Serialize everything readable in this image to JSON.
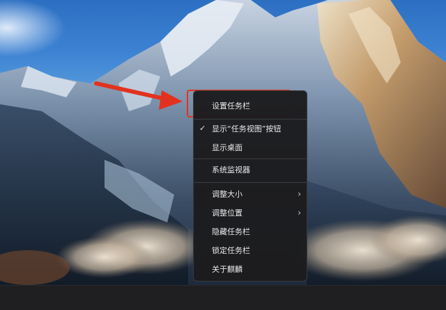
{
  "context_menu": {
    "items": [
      {
        "label": "设置任务栏"
      },
      {
        "label": "显示“任务视图”按钮",
        "checked": true,
        "check_glyph": "✓"
      },
      {
        "label": "显示桌面"
      },
      {
        "label": "系统监视器"
      },
      {
        "label": "调整大小",
        "submenu": true,
        "chevron": "›"
      },
      {
        "label": "调整位置",
        "submenu": true,
        "chevron": "›"
      },
      {
        "label": "隐藏任务栏"
      },
      {
        "label": "锁定任务栏"
      },
      {
        "label": "关于麒麟"
      }
    ]
  },
  "annotation": {
    "arrow_color": "#e2321f",
    "box_color": "#e2321f"
  },
  "taskbar": {
    "color": "#1f1f22"
  }
}
